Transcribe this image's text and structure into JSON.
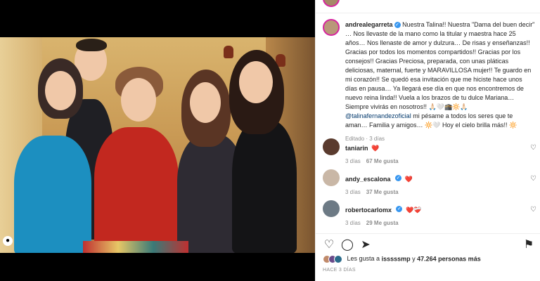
{
  "post": {
    "author": "andrealegarreta",
    "caption_parts": [
      "Nuestra Talina!! Nuestra \"Dama del buen decir\" … Nos llevaste de la mano como la titular y maestra hace 25 años… Nos llenaste de amor y dulzura… De risas y enseñanzas!! Gracias por todos los momentos compartidos!! Gracias por los consejos!! Gracias Preciosa, preparada, con unas pláticas deliciosas, maternal, fuerte y MARAVILLOSA mujer!! Te guardo en mi corazón!! Se quedó esa invitación que me hiciste hace unos días en pausa… Ya llegará ese día en que nos encontremos de nuevo reina linda!! Vuela a los brazos de tu dulce Mariana… Siempre vivirás en nosotros!! 🙏🏻🤍🕋🔆🙏🏻 ",
      "@talinafernandezoficial",
      " mi pésame a todos los seres que te aman… Familia y amigos… 🔆🤍 Hoy el cielo brilla más!! 🔆"
    ],
    "edited": "Editado",
    "edited_time": "3 días"
  },
  "comments": [
    {
      "handle": "taniarin",
      "text": "",
      "time": "3 días",
      "likes": "67 Me gusta",
      "avatar_color": "#5a3b2e",
      "has_heart": true
    },
    {
      "handle": "andy_escalona",
      "text": "",
      "time": "3 días",
      "likes": "37 Me gusta",
      "avatar_color": "#c9b7a6",
      "has_heart": true
    },
    {
      "handle": "robertocarlomx",
      "text": "",
      "time": "3 días",
      "likes": "29 Me gusta",
      "avatar_color": "#6d7a85",
      "has_heart": true,
      "extra": "❤️‍🩹"
    }
  ],
  "likes": {
    "prefix": "Les gusta a",
    "user": "isssssmp",
    "middle": "y",
    "count": "47.264 personas más"
  },
  "time_ago": "HACE 3 DÍAS",
  "colors": {
    "verified": "#3897f0",
    "heart": "#ed4956",
    "link": "#00376b"
  }
}
